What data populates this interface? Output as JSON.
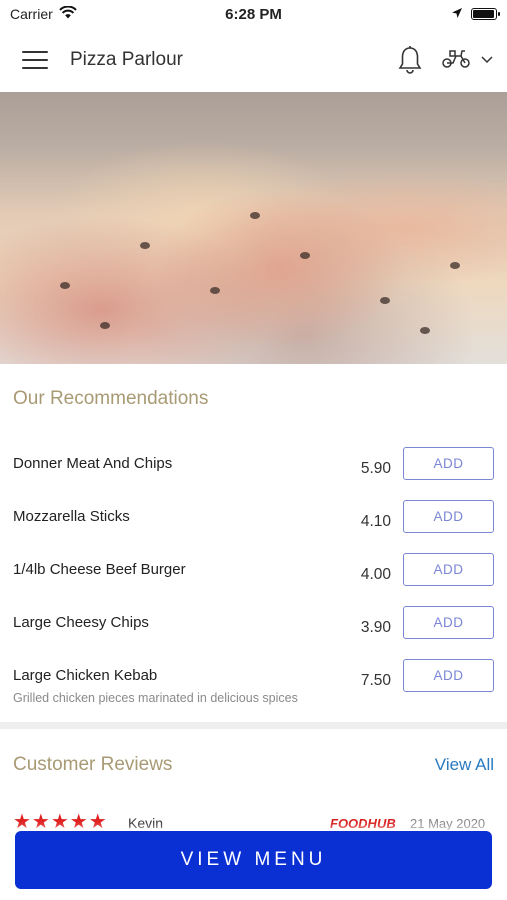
{
  "status_bar": {
    "carrier": "Carrier",
    "time": "6:28 PM"
  },
  "header": {
    "title": "Pizza Parlour"
  },
  "recommendations": {
    "title": "Our Recommendations",
    "items": [
      {
        "name": "Donner Meat And Chips",
        "description": "",
        "price": "5.90",
        "action": "ADD"
      },
      {
        "name": "Mozzarella Sticks",
        "description": "",
        "price": "4.10",
        "action": "ADD"
      },
      {
        "name": "1/4lb Cheese Beef Burger",
        "description": "",
        "price": "4.00",
        "action": "ADD"
      },
      {
        "name": "Large Cheesy Chips",
        "description": "",
        "price": "3.90",
        "action": "ADD"
      },
      {
        "name": "Large Chicken Kebab",
        "description": "Grilled chicken pieces marinated in delicious spices",
        "price": "7.50",
        "action": "ADD"
      }
    ]
  },
  "reviews": {
    "title": "Customer Reviews",
    "view_all": "View All",
    "first_review": {
      "stars": "★★★★★",
      "reviewer": "Kevin",
      "source": "FOODHUB",
      "date": "21 May 2020"
    }
  },
  "footer": {
    "cta": "VIEW MENU"
  },
  "colors": {
    "accent": "#0a2fd3",
    "section_title": "#a89a74",
    "add_border": "#7b86d6",
    "link": "#2a7abf"
  },
  "icons": [
    "menu-icon",
    "bell-icon",
    "scooter-icon",
    "chevron-down-icon",
    "wifi-icon",
    "location-arrow-icon",
    "battery-icon"
  ]
}
